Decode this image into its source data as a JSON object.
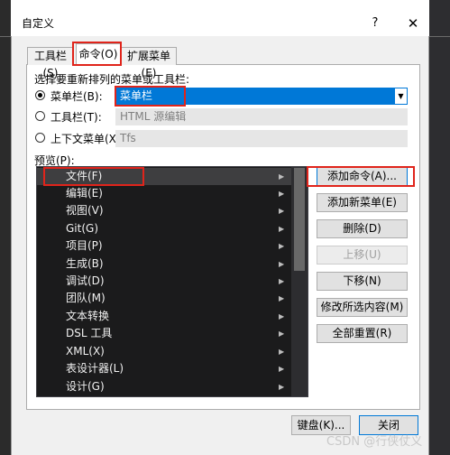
{
  "dialog": {
    "title": "自定义",
    "help": "?",
    "close": "✕"
  },
  "tabs": [
    {
      "label": "工具栏(S)"
    },
    {
      "label": "命令(O)"
    },
    {
      "label": "扩展菜单(E)"
    }
  ],
  "select_label": "选择要重新排列的菜单或工具栏:",
  "options": {
    "menubar": {
      "label": "菜单栏(B):",
      "value": "菜单栏"
    },
    "toolbar": {
      "label": "工具栏(T):",
      "value": "HTML 源编辑"
    },
    "context": {
      "label": "上下文菜单(X):",
      "value": "Tfs"
    }
  },
  "preview_label": "预览(P):",
  "menu_items": [
    {
      "label": "文件(F)"
    },
    {
      "label": "编辑(E)"
    },
    {
      "label": "视图(V)"
    },
    {
      "label": "Git(G)"
    },
    {
      "label": "项目(P)"
    },
    {
      "label": "生成(B)"
    },
    {
      "label": "调试(D)"
    },
    {
      "label": "团队(M)"
    },
    {
      "label": "文本转换"
    },
    {
      "label": "DSL 工具"
    },
    {
      "label": "XML(X)"
    },
    {
      "label": "表设计器(L)"
    },
    {
      "label": "设计(G)"
    }
  ],
  "buttons": {
    "add_command": "添加命令(A)...",
    "add_menu": "添加新菜单(E)",
    "delete": "删除(D)",
    "move_up": "上移(U)",
    "move_down": "下移(N)",
    "modify_selection": "修改所选内容(M)",
    "reset_all": "全部重置(R)"
  },
  "footer": {
    "keyboard": "键盘(K)...",
    "close": "关闭"
  },
  "watermark": "CSDN @行侠仗义",
  "colors": {
    "accent": "#0078d7",
    "annotation": "#e0241b",
    "dark_list_bg": "#1b1b1c"
  }
}
